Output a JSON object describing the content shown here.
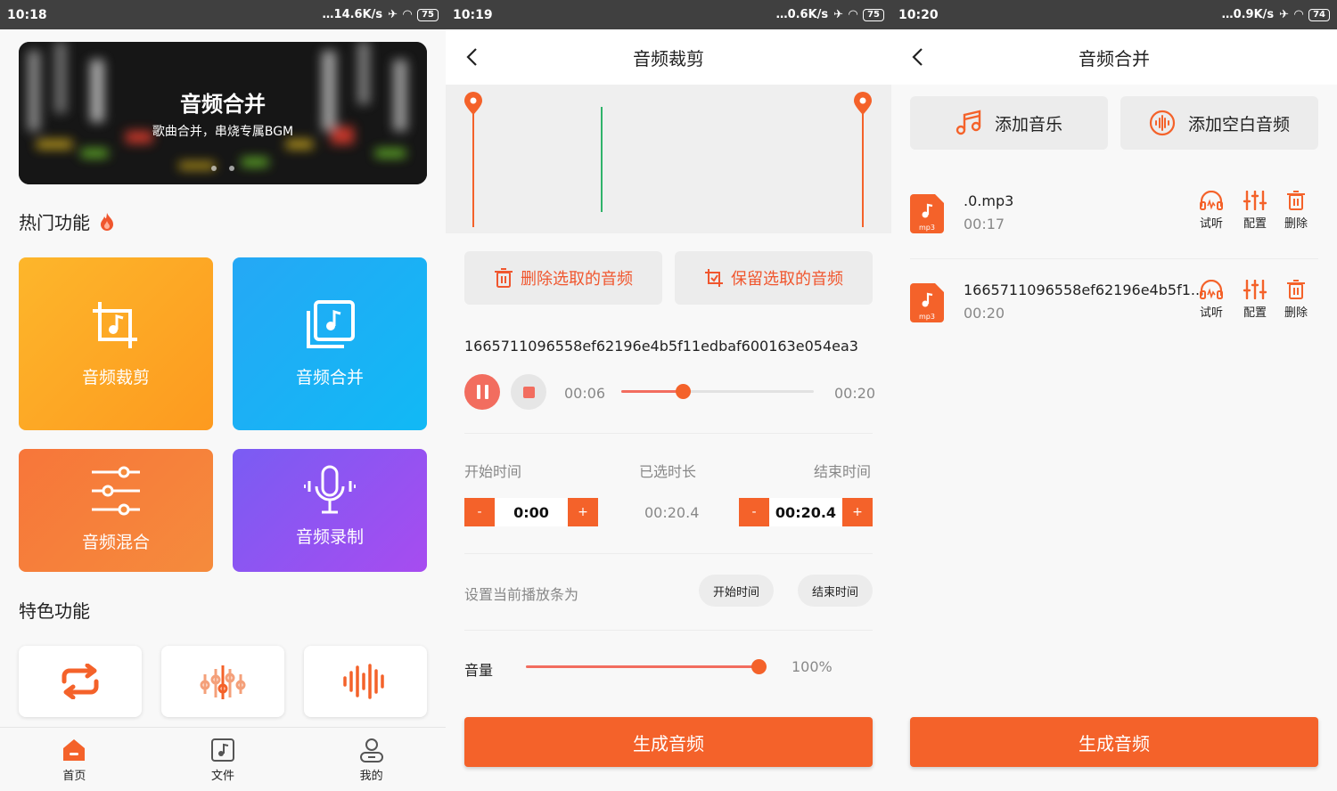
{
  "screen1": {
    "status": {
      "time": "10:18",
      "speed": "14.6K/s",
      "battery": "75"
    },
    "banner": {
      "title": "音频合并",
      "subtitle": "歌曲合并，串烧专属BGM"
    },
    "hot_title": "热门功能",
    "cards": [
      {
        "label": "音频裁剪",
        "icon": "crop-icon"
      },
      {
        "label": "音频合并",
        "icon": "music-library-icon"
      },
      {
        "label": "音频混合",
        "icon": "sliders-icon"
      },
      {
        "label": "音频录制",
        "icon": "microphone-icon"
      }
    ],
    "feature_title": "特色功能",
    "tabs": [
      {
        "label": "首页",
        "icon": "home-icon"
      },
      {
        "label": "文件",
        "icon": "music-file-icon"
      },
      {
        "label": "我的",
        "icon": "user-icon"
      }
    ]
  },
  "screen2": {
    "status": {
      "time": "10:19",
      "speed": "0.6K/s",
      "battery": "75"
    },
    "title": "音频裁剪",
    "delete_selected": "删除选取的音频",
    "keep_selected": "保留选取的音频",
    "filename": "1665711096558ef62196e4b5f11edbaf600163e054ea3",
    "player": {
      "current": "00:06",
      "total": "00:20",
      "progress": 0.32
    },
    "labels": {
      "start": "开始时间",
      "selected": "已选时长",
      "end": "结束时间"
    },
    "start_value": "0:00",
    "selected_value": "00:20.4",
    "end_value": "00:20.4",
    "minus": "-",
    "plus": "+",
    "set_playhead_label": "设置当前播放条为",
    "set_start": "开始时间",
    "set_end": "结束时间",
    "volume_label": "音量",
    "volume_value": "100%",
    "volume_level": 1.0,
    "generate": "生成音频"
  },
  "screen3": {
    "status": {
      "time": "10:20",
      "speed": "0.9K/s",
      "battery": "74"
    },
    "title": "音频合并",
    "add_music": "添加音乐",
    "add_blank": "添加空白音频",
    "files": [
      {
        "name": ".0.mp3",
        "duration": "00:17",
        "badge": "mp3"
      },
      {
        "name": "1665711096558ef62196e4b5f1...",
        "duration": "00:20",
        "badge": "mp3"
      }
    ],
    "actions": {
      "listen": "试听",
      "config": "配置",
      "delete": "删除"
    },
    "generate": "生成音频"
  },
  "colors": {
    "accent": "#f4622a",
    "pink": "#f26d5f",
    "gray_text": "#888888"
  }
}
